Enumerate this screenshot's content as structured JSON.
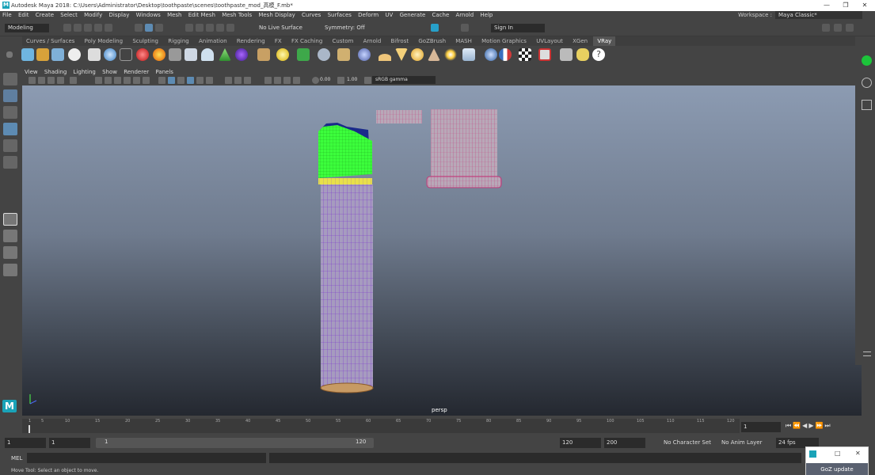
{
  "titlebar": {
    "title": "Autodesk Maya 2018: C:\\Users\\Administrator\\Desktop\\toothpaste\\scenes\\toothpaste_mod_高模_F.mb*",
    "logo": "M",
    "minimize": "—",
    "restore": "❐",
    "close": "✕"
  },
  "menubar": {
    "items": [
      "File",
      "Edit",
      "Create",
      "Select",
      "Modify",
      "Display",
      "Windows",
      "Mesh",
      "Edit Mesh",
      "Mesh Tools",
      "Mesh Display",
      "Curves",
      "Surfaces",
      "Deform",
      "UV",
      "Generate",
      "Cache",
      "Arnold",
      "Help"
    ],
    "workspace_label": "Workspace :",
    "workspace_value": "Maya Classic*"
  },
  "statusline": {
    "menuset": "Modeling",
    "live_surface": "No Live Surface",
    "symmetry": "Symmetry: Off",
    "sign_in": "Sign In"
  },
  "shelf_tabs": [
    "Curves / Surfaces",
    "Poly Modeling",
    "Sculpting",
    "Rigging",
    "Animation",
    "Rendering",
    "FX",
    "FX Caching",
    "Custom",
    "Arnold",
    "Bifrost",
    "GoZBrush",
    "MASH",
    "Motion Graphics",
    "UVLayout",
    "XGen",
    "VRay"
  ],
  "active_shelf_tab": "VRay",
  "panel_menu": [
    "View",
    "Shading",
    "Lighting",
    "Show",
    "Renderer",
    "Panels"
  ],
  "panel_toolbar": {
    "exposure": "0.00",
    "gamma": "1.00",
    "color_space": "sRGB gamma"
  },
  "viewport": {
    "camera_label": "persp"
  },
  "timeslider": {
    "ticks": [
      "1",
      "5",
      "10",
      "15",
      "20",
      "25",
      "30",
      "35",
      "40",
      "45",
      "50",
      "55",
      "60",
      "65",
      "70",
      "75",
      "80",
      "85",
      "90",
      "95",
      "100",
      "105",
      "110",
      "115",
      "120"
    ],
    "current_frame": "1"
  },
  "rangeslider": {
    "start": "1",
    "start_inner": "1",
    "range_start_label": "1",
    "range_end_label": "120",
    "end_inner": "120",
    "end": "200",
    "character_set": "No Character Set",
    "anim_layer": "No Anim Layer",
    "fps": "24 fps"
  },
  "cmdline": {
    "label": "MEL"
  },
  "helpline": {
    "text": "Move Tool: Select an object to move."
  },
  "goz": {
    "label": "GoZ update"
  },
  "colors": {
    "background": "#444444",
    "viewport_top": "#8c9bb2",
    "viewport_bottom": "#242830",
    "wire_purple": "#8a3fd1",
    "wire_green": "#3cff3c",
    "wire_pink": "#cc3a7e",
    "accent_blue": "#1aa3b8"
  }
}
